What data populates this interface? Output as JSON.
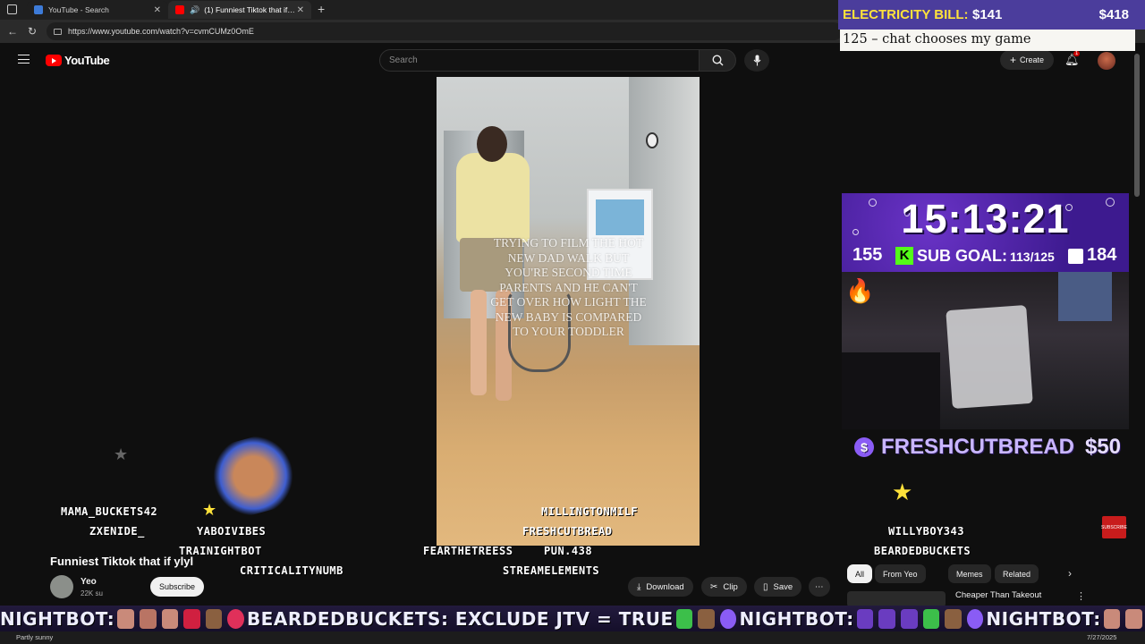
{
  "browser": {
    "tabs": [
      {
        "label": "YouTube - Search",
        "active": false
      },
      {
        "label": "(1) Funniest Tiktok that if ylyl",
        "active": true
      }
    ],
    "url": "https://www.youtube.com/watch?v=cvmCUMz0OmE"
  },
  "youtube": {
    "logo_text": "YouTube",
    "search_placeholder": "Search",
    "create_label": "Create",
    "notification_count": "1"
  },
  "video": {
    "caption": "TRYING TO FILM THE HOT NEW DAD WALK BUT YOU'RE SECOND TIME PARENTS AND HE CAN'T GET OVER HOW LIGHT THE NEW BABY IS COMPARED TO YOUR TODDLER",
    "title": "Funniest Tiktok that if ylyl",
    "channel_name": "Yeo",
    "channel_subs": "22K su",
    "subscribe_label": "Subscribe",
    "actions": {
      "download": "Download",
      "clip": "Clip",
      "save": "Save"
    }
  },
  "recommendations": {
    "chips": [
      "All",
      "From Yeo",
      "Memes",
      "Related"
    ],
    "first_title": "Cheaper Than Takeout"
  },
  "overlay": {
    "electricity_label": "ELECTRICITY BILL:",
    "electricity_current": "$141",
    "electricity_goal": "$418",
    "goal_line": "125 – chat chooses my game",
    "timer": "15:13:21",
    "left_count": "155",
    "sub_goal_label": "SUB GOAL:",
    "sub_goal_value": "113/125",
    "right_count": "184",
    "donation_name": "FRESHCUTBREAD",
    "donation_amount": "$50",
    "subscribe_badge": "SUBSCRIBE",
    "chat_names": [
      "MAMA_BUCKETS42",
      "ZXENIDE_",
      "YABOIVIBES",
      "TRAINIGHTBOT",
      "CRITICALITYNUMB",
      "FEARTHETREESS",
      "PUN.438",
      "STREAMELEMENTS",
      "MILLINGTONMILF",
      "FRESHCUTBREAD",
      "WILLYBOY343",
      "BEARDEDBUCKETS"
    ]
  },
  "ticker": {
    "seg1": "NIGHTBOT:",
    "seg2": "BEARDEDBUCKETS: EXCLUDE JTV = TRUE",
    "seg3": "NIGHTBOT:",
    "seg4": "NIGHTBOT:"
  },
  "taskbar": {
    "weather": "Partly sunny",
    "date": "7/27/2025"
  }
}
